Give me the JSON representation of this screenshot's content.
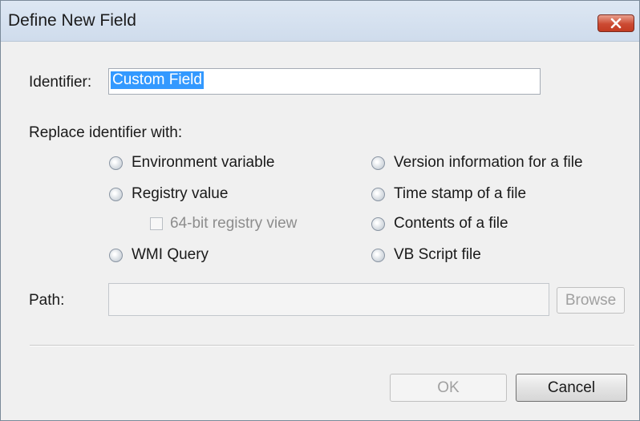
{
  "dialog": {
    "title": "Define New Field"
  },
  "identifier": {
    "label": "Identifier:",
    "value": "Custom Field"
  },
  "replace": {
    "label": "Replace identifier with:",
    "options": {
      "environment_variable": "Environment variable",
      "registry_value": "Registry value",
      "registry_64bit": "64-bit registry view",
      "wmi_query": "WMI Query",
      "version_information": "Version information for a file",
      "time_stamp": "Time stamp of a file",
      "contents_of_file": "Contents of a file",
      "vb_script": "VB Script file"
    }
  },
  "path": {
    "label": "Path:",
    "value": "",
    "browse_label": "Browse"
  },
  "buttons": {
    "ok_label": "OK",
    "cancel_label": "Cancel"
  },
  "colors": {
    "selection": "#3399ff",
    "close_button": "#c23b22"
  },
  "icons": {
    "close": "close-icon"
  }
}
